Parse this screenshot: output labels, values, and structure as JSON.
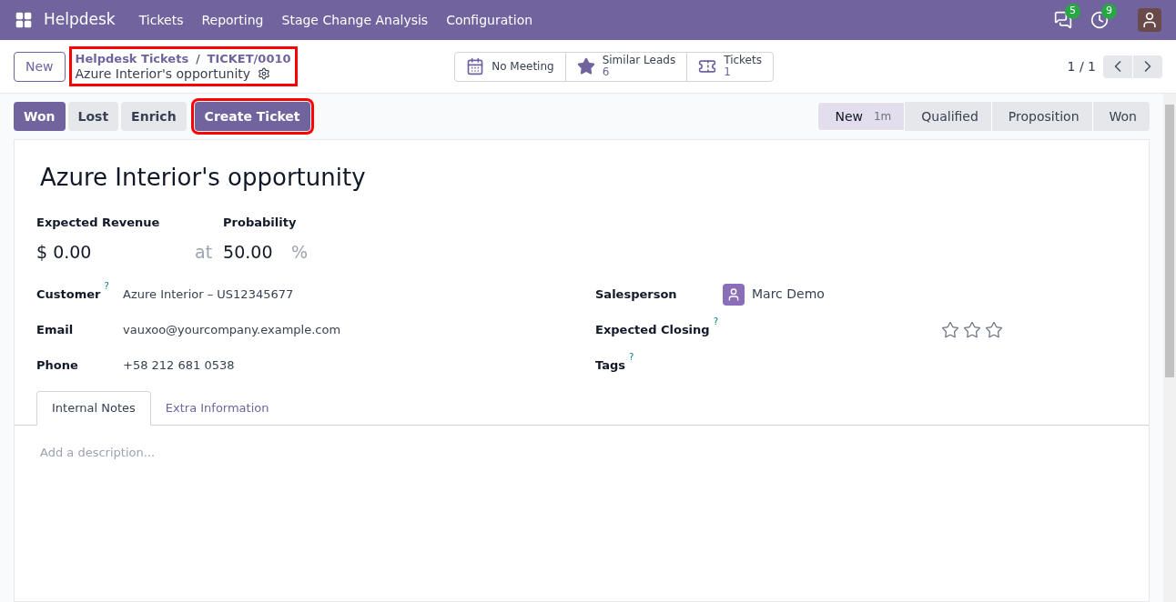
{
  "navbar": {
    "app": "Helpdesk",
    "menu": [
      "Tickets",
      "Reporting",
      "Stage Change Analysis",
      "Configuration"
    ],
    "messages_badge": "5",
    "activities_badge": "9"
  },
  "control_panel": {
    "new_button": "New",
    "breadcrumb": {
      "parent": "Helpdesk Tickets",
      "separator": "/",
      "current": "TICKET/0010",
      "record": "Azure Interior's opportunity",
      "highlighted": true
    },
    "smart_buttons": [
      {
        "kind": "calendar",
        "label": "No Meeting"
      },
      {
        "kind": "star",
        "label": "Similar Leads",
        "count": "6"
      },
      {
        "kind": "ticket",
        "label": "Tickets",
        "count": "1"
      }
    ],
    "pager": "1 / 1"
  },
  "actions": [
    {
      "label": "Won",
      "primary": true,
      "highlighted": false
    },
    {
      "label": "Lost",
      "primary": false,
      "highlighted": false
    },
    {
      "label": "Enrich",
      "primary": false,
      "highlighted": false
    },
    {
      "label": "Create Ticket",
      "primary": true,
      "highlighted": true
    }
  ],
  "stages": [
    {
      "label": "New",
      "duration": "1m",
      "selected": true
    },
    {
      "label": "Qualified",
      "selected": false
    },
    {
      "label": "Proposition",
      "selected": false
    },
    {
      "label": "Won",
      "selected": false
    }
  ],
  "form": {
    "title": "Azure Interior's opportunity",
    "revenue_label": "Expected Revenue",
    "revenue": "$ 0.00",
    "at": "at",
    "probability_label": "Probability",
    "probability": "50.00",
    "percent": "%",
    "left_fields": [
      {
        "label": "Customer",
        "help": "?",
        "value": "Azure Interior – US12345677"
      },
      {
        "label": "Email",
        "value": "vauxoo@yourcompany.example.com"
      },
      {
        "label": "Phone",
        "value": "+58 212 681 0538"
      }
    ],
    "right_fields": [
      {
        "kind": "user",
        "label": "Salesperson",
        "value": "Marc Demo"
      },
      {
        "kind": "priority",
        "label": "Expected Closing",
        "help": "?",
        "stars": 0
      },
      {
        "kind": "tags",
        "label": "Tags",
        "help": "?"
      }
    ],
    "tabs": [
      {
        "label": "Internal Notes",
        "selected": true
      },
      {
        "label": "Extra Information",
        "selected": false
      }
    ],
    "description_placeholder": "Add a description..."
  }
}
